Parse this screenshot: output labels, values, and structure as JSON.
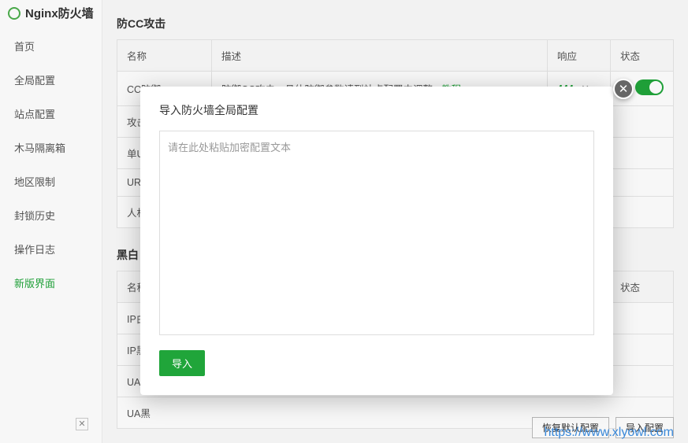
{
  "app_title": "Nginx防火墙",
  "sidebar": {
    "items": [
      {
        "label": "首页"
      },
      {
        "label": "全局配置"
      },
      {
        "label": "站点配置"
      },
      {
        "label": "木马隔离箱"
      },
      {
        "label": "地区限制"
      },
      {
        "label": "封锁历史"
      },
      {
        "label": "操作日志"
      },
      {
        "label": "新版界面"
      }
    ]
  },
  "section1": {
    "title": "防CC攻击",
    "headers": {
      "name": "名称",
      "desc": "描述",
      "resp": "响应",
      "status": "状态"
    },
    "rows": [
      {
        "name": "CC防御",
        "desc_a": "防御CC攻击，具体防御参数请到站点配置中调整 - ",
        "desc_b": "教程",
        "resp": "444",
        "resp_x": "✕"
      },
      {
        "name": "攻击"
      },
      {
        "name": "单U"
      },
      {
        "name": "URL"
      },
      {
        "name": "人机"
      }
    ]
  },
  "section2": {
    "title": "黑白",
    "headers": {
      "name": "名称",
      "status": "状态"
    },
    "rows": [
      {
        "name": "IP白"
      },
      {
        "name": "IP黑"
      },
      {
        "name": "UA白"
      },
      {
        "name": "UA黑"
      }
    ]
  },
  "bottom": {
    "restore": "恢复默认配置",
    "import": "导入配置"
  },
  "modal": {
    "title": "导入防火墙全局配置",
    "placeholder": "请在此处粘贴加密配置文本",
    "submit": "导入"
  },
  "watermark": "https://www.xlyowl.com"
}
